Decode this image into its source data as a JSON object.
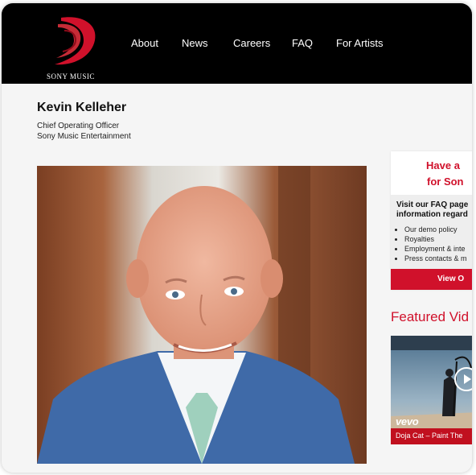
{
  "header": {
    "logo_text": "SONY MUSIC",
    "nav": [
      {
        "label": "About"
      },
      {
        "label": "News"
      },
      {
        "label": "Careers"
      },
      {
        "label": "FAQ"
      },
      {
        "label": "For Artists"
      }
    ]
  },
  "profile": {
    "name": "Kevin Kelleher",
    "title_line1": "Chief Operating Officer",
    "title_line2": "Sony Music Entertainment"
  },
  "sidebar": {
    "cta_heading_line1": "Have a",
    "cta_heading_line2": "for Son",
    "cta_intro_line1": "Visit our FAQ page",
    "cta_intro_line2": "information regard",
    "cta_list": [
      "Our demo policy",
      "Royalties",
      "Employment & inte",
      "Press contacts & m"
    ],
    "cta_button": "View O",
    "featured_heading": "Featured Vid",
    "video_brand": "vevo",
    "video_caption": "Doja Cat – Paint The"
  },
  "colors": {
    "accent": "#d0112b",
    "header_bg": "#000000",
    "page_bg": "#f5f5f5"
  }
}
